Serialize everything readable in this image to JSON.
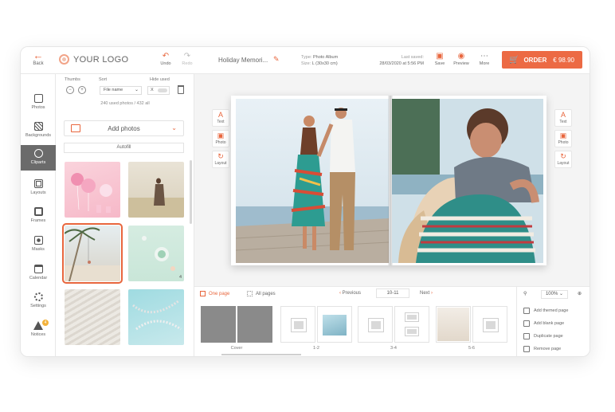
{
  "header": {
    "back_label": "Back",
    "logo_text": "YOUR LOGO",
    "undo_label": "Undo",
    "redo_label": "Redo",
    "project_name": "Holiday Memori...",
    "type_label": "Type:",
    "type_value": "Photo Album",
    "size_label": "Size:",
    "size_value": "L (30x30 cm)",
    "last_saved_label": "Last saved:",
    "last_saved_value": "28/03/2020 at 5:56 PM",
    "save_label": "Save",
    "preview_label": "Preview",
    "more_label": "More",
    "order_label": "ORDER",
    "order_price": "€ 98.90"
  },
  "sidebar": {
    "items": [
      {
        "label": "Photos"
      },
      {
        "label": "Backgrounds"
      },
      {
        "label": "Cliparts"
      },
      {
        "label": "Layouts"
      },
      {
        "label": "Frames"
      },
      {
        "label": "Masks"
      },
      {
        "label": "Calendar"
      },
      {
        "label": "Settings"
      },
      {
        "label": "Notices"
      }
    ],
    "notices_badge": "4"
  },
  "panel": {
    "thumbs_label": "Thumbs",
    "sort_label": "Sort",
    "sort_value": "File name",
    "hide_used_label": "Hide used",
    "hide_used_value": "X",
    "used_text": "240 used photos / 432 all",
    "add_photos_label": "Add photos",
    "autofill_label": "Autofill",
    "thumb_count": "4"
  },
  "tools": {
    "text_label": "Text",
    "photo_label": "Photo",
    "layout_label": "Layout"
  },
  "bottom": {
    "one_page_label": "One page",
    "all_pages_label": "All pages",
    "previous_label": "Previous",
    "page_number": "10-11",
    "next_label": "Next",
    "spreads": [
      {
        "label": "Cover"
      },
      {
        "label": "1-2"
      },
      {
        "label": "3-4"
      },
      {
        "label": "5-6"
      }
    ]
  },
  "right_panel": {
    "zoom_value": "100%",
    "add_themed_page": "Add themed page",
    "add_blank_page": "Add blank page",
    "duplicate_page": "Duplicate page",
    "remove_page": "Remove page"
  },
  "colors": {
    "accent": "#e8663d",
    "order_bg": "#ec6a44",
    "sidebar_active": "#6b6b6b"
  }
}
